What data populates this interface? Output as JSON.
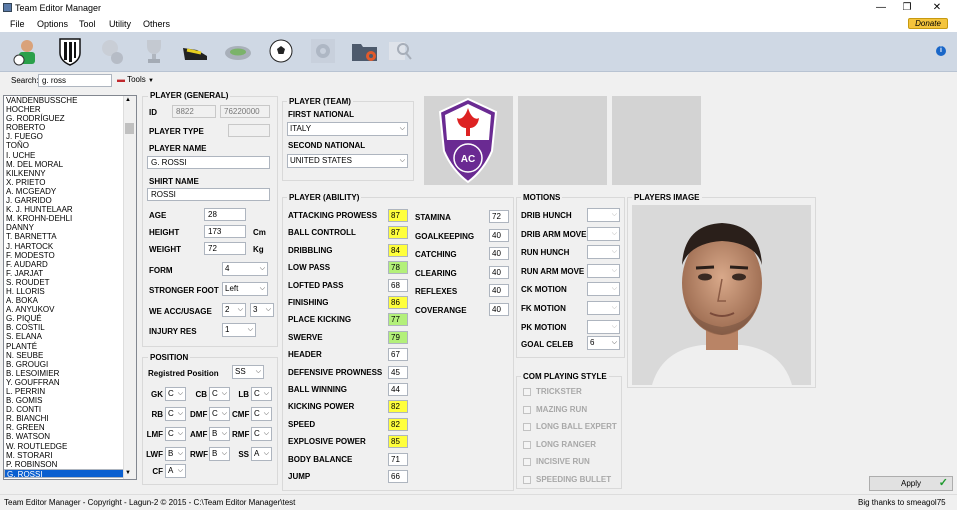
{
  "window": {
    "title": "Team Editor Manager",
    "minimize": "—",
    "restore": "❐",
    "close": "✕"
  },
  "menu": [
    "File",
    "Options",
    "Tool",
    "Utility",
    "Others"
  ],
  "donate": "Donate",
  "search": {
    "label": "Search:",
    "value": "g. ross",
    "tools": "Tools"
  },
  "players": [
    "VANDENBUSSCHE",
    "HOCHER",
    "G. RODRÍGUEZ",
    "ROBERTO",
    "J. FUEGO",
    "TOÑO",
    "I. UCHE",
    "M. DEL MORAL",
    "KILKENNY",
    "X. PRIETO",
    "A. MCGEADY",
    "J. GARRIDO",
    "K. J. HUNTELAAR",
    "M. KROHN-DEHLI",
    "DANNY",
    "T. BARNETTA",
    "J. HARTOCK",
    "F. MODESTO",
    "F. AUDARD",
    "F. JARJAT",
    "S. ROUDET",
    "H. LLORIS",
    "A. BOKA",
    "A. ANYUKOV",
    "G. PIQUÉ",
    "B. COSTIL",
    "S. ELANA",
    "PLANTÉ",
    "N. SEUBE",
    "B. GROUGI",
    "B. LESOIMIER",
    "Y. GOUFFRAN",
    "L. PERRIN",
    "B. GOMIS",
    "D. CONTI",
    "R. BIANCHI",
    "R. GREEN",
    "B. WATSON",
    "W. ROUTLEDGE",
    "M. STORARI",
    "P. ROBINSON",
    "G. ROSSI"
  ],
  "general": {
    "header": "PLAYER (GENERAL)",
    "id_label": "ID",
    "id1": "8822",
    "id2": "76220000",
    "type_label": "PLAYER TYPE",
    "name_label": "PLAYER NAME",
    "name": "G. ROSSI",
    "shirt_label": "SHIRT NAME",
    "shirt": "ROSSI",
    "age_label": "AGE",
    "age": "28",
    "height_label": "HEIGHT",
    "height": "173",
    "height_unit": "Cm",
    "weight_label": "WEIGHT",
    "weight": "72",
    "weight_unit": "Kg",
    "form_label": "FORM",
    "form": "4",
    "foot_label": "STRONGER FOOT",
    "foot": "Left",
    "we_label": "WE ACC/USAGE",
    "we1": "2",
    "we2": "3",
    "inj_label": "INJURY RES",
    "inj": "1"
  },
  "position": {
    "header": "POSITION",
    "reg_label": "Registred Position",
    "reg": "SS",
    "slots": [
      [
        "GK",
        "C"
      ],
      [
        "CB",
        "C"
      ],
      [
        "LB",
        "C"
      ],
      [
        "RB",
        "C"
      ],
      [
        "DMF",
        "C"
      ],
      [
        "CMF",
        "C"
      ],
      [
        "LMF",
        "C"
      ],
      [
        "AMF",
        "B"
      ],
      [
        "RMF",
        "C"
      ],
      [
        "LWF",
        "B"
      ],
      [
        "RWF",
        "B"
      ],
      [
        "SS",
        "A"
      ],
      [
        "CF",
        "A"
      ]
    ]
  },
  "team": {
    "header": "PLAYER (TEAM)",
    "first_label": "FIRST NATIONAL",
    "first": "ITALY",
    "second_label": "SECOND NATIONAL",
    "second": "UNITED STATES"
  },
  "ability": {
    "header": "PLAYER (ABILITY)",
    "left": [
      [
        "ATTACKING PROWESS",
        "87",
        "y"
      ],
      [
        "BALL CONTROLL",
        "87",
        "y"
      ],
      [
        "DRIBBLING",
        "84",
        "y"
      ],
      [
        "LOW PASS",
        "78",
        "g"
      ],
      [
        "LOFTED PASS",
        "68",
        ""
      ],
      [
        "FINISHING",
        "86",
        "y"
      ],
      [
        "PLACE KICKING",
        "77",
        "g"
      ],
      [
        "SWERVE",
        "79",
        "g"
      ],
      [
        "HEADER",
        "67",
        ""
      ],
      [
        "DEFENSIVE PROWNESS",
        "45",
        ""
      ],
      [
        "BALL WINNING",
        "44",
        ""
      ],
      [
        "KICKING POWER",
        "82",
        "y"
      ],
      [
        "SPEED",
        "82",
        "y"
      ],
      [
        "EXPLOSIVE POWER",
        "85",
        "y"
      ],
      [
        "BODY BALANCE",
        "71",
        ""
      ],
      [
        "JUMP",
        "66",
        ""
      ]
    ],
    "right": [
      [
        "STAMINA",
        "72"
      ],
      [
        "GOALKEEPING",
        "40"
      ],
      [
        "CATCHING",
        "40"
      ],
      [
        "CLEARING",
        "40"
      ],
      [
        "REFLEXES",
        "40"
      ],
      [
        "COVERANGE",
        "40"
      ]
    ]
  },
  "motions": {
    "header": "MOTIONS",
    "items": [
      "DRIB HUNCH",
      "DRIB ARM MOVE",
      "RUN HUNCH",
      "RUN ARM MOVE",
      "CK MOTION",
      "FK MOTION",
      "PK MOTION"
    ],
    "goal_label": "GOAL CELEB",
    "goal": "6"
  },
  "style": {
    "header": "COM PLAYING STYLE",
    "items": [
      "TRICKSTER",
      "MAZING RUN",
      "LONG BALL EXPERT",
      "LONG RANGER",
      "INCISIVE RUN",
      "SPEEDING BULLET"
    ]
  },
  "image": {
    "header": "PLAYERS IMAGE"
  },
  "apply": "Apply",
  "status": {
    "left": "Team Editor Manager - Copyright - Lagun-2 © 2015 -  C:\\Team Editor Manager\\test",
    "right": "Big thanks to smeagol75"
  },
  "colors": {
    "yellow": "#ffff3c",
    "green": "#b3f07a",
    "selection": "#0a5fd0",
    "fiorentina": "#6a2a92"
  }
}
